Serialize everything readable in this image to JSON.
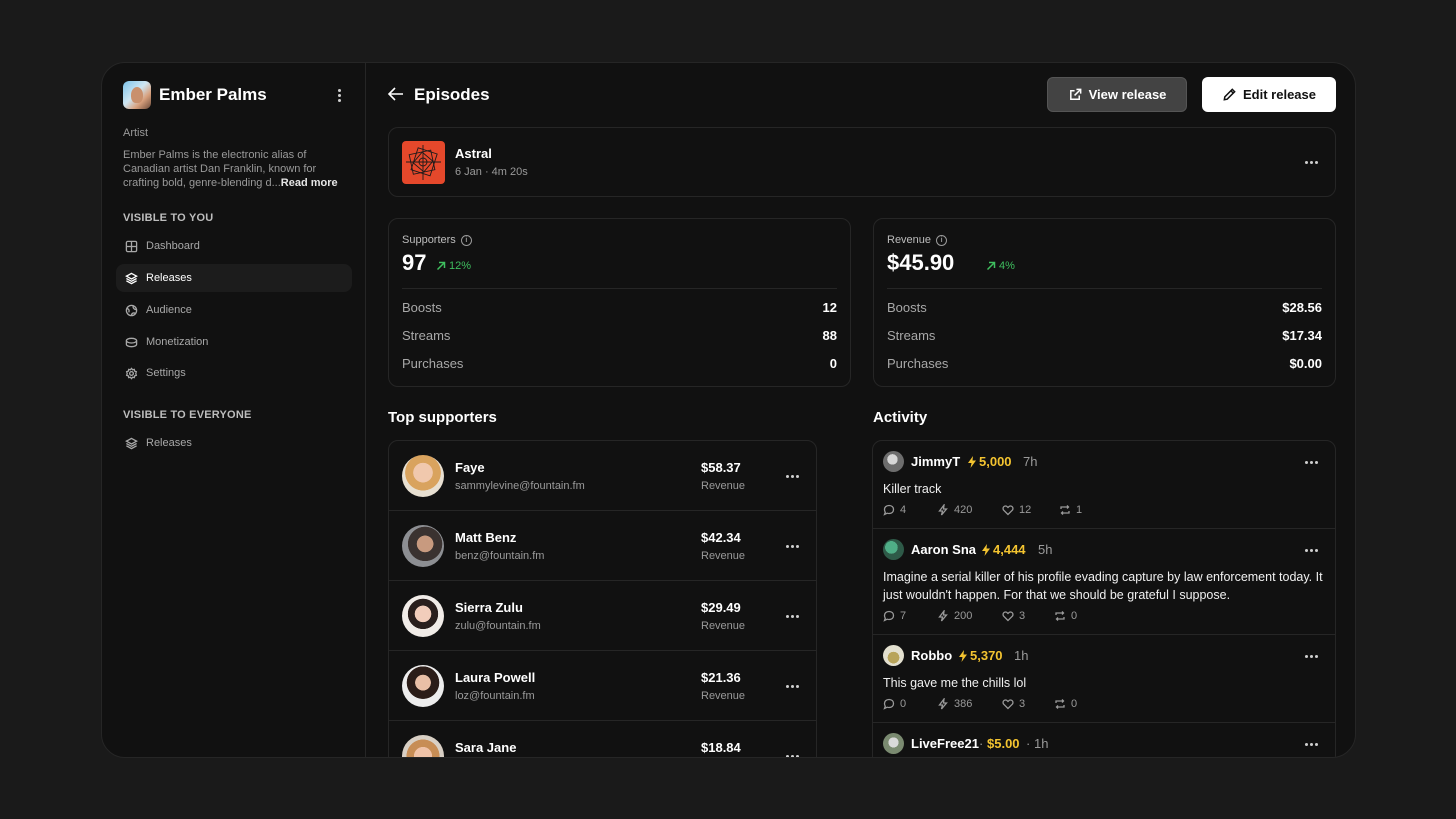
{
  "sidebar": {
    "artist_name": "Ember Palms",
    "artist_role": "Artist",
    "artist_bio": "Ember Palms is the electronic alias of Canadian artist Dan Franklin, known for crafting bold, genre-blending d...",
    "read_more": "Read more",
    "section_visible_to_you": "VISIBLE TO YOU",
    "items_you": [
      {
        "label": "Dashboard",
        "icon": "grid-icon"
      },
      {
        "label": "Releases",
        "icon": "layers-icon",
        "active": true
      },
      {
        "label": "Audience",
        "icon": "globe-icon"
      },
      {
        "label": "Monetization",
        "icon": "coins-icon"
      },
      {
        "label": "Settings",
        "icon": "gear-icon"
      }
    ],
    "section_visible_to_everyone": "VISIBLE TO EVERYONE",
    "items_everyone": [
      {
        "label": "Releases",
        "icon": "layers-icon"
      }
    ]
  },
  "header": {
    "title": "Episodes",
    "view_release": "View release",
    "edit_release": "Edit release"
  },
  "release": {
    "title": "Astral",
    "meta": "6 Jan · 4m 20s",
    "art_color": "#e5482b"
  },
  "stats": {
    "supporters": {
      "label": "Supporters",
      "value": "97",
      "change": "12%",
      "rows": [
        {
          "label": "Boosts",
          "value": "12"
        },
        {
          "label": "Streams",
          "value": "88"
        },
        {
          "label": "Purchases",
          "value": "0"
        }
      ]
    },
    "revenue": {
      "label": "Revenue",
      "value": "$45.90",
      "change": "4%",
      "rows": [
        {
          "label": "Boosts",
          "value": "$28.56"
        },
        {
          "label": "Streams",
          "value": "$17.34"
        },
        {
          "label": "Purchases",
          "value": "$0.00"
        }
      ]
    }
  },
  "top_supporters": {
    "title": "Top supporters",
    "items": [
      {
        "name": "Faye",
        "email": "sammylevine@fountain.fm",
        "amount": "$58.37",
        "amount_label": "Revenue"
      },
      {
        "name": "Matt Benz",
        "email": "benz@fountain.fm",
        "amount": "$42.34",
        "amount_label": "Revenue"
      },
      {
        "name": "Sierra Zulu",
        "email": "zulu@fountain.fm",
        "amount": "$29.49",
        "amount_label": "Revenue"
      },
      {
        "name": "Laura Powell",
        "email": "loz@fountain.fm",
        "amount": "$21.36",
        "amount_label": "Revenue"
      },
      {
        "name": "Sara Jane",
        "email": "",
        "amount": "$18.84",
        "amount_label": ""
      }
    ]
  },
  "activity": {
    "title": "Activity",
    "items": [
      {
        "user": "JimmyT",
        "amount": "5,000",
        "time": "7h",
        "text": "Killer track",
        "comments": "4",
        "boosts": "420",
        "likes": "12",
        "reposts": "1"
      },
      {
        "user": "Aaron Sna",
        "amount": "4,444",
        "time": "5h",
        "text": "Imagine a serial killer of his profile evading capture by law enforcement today. It just wouldn't happen. For that we should be grateful I suppose.",
        "comments": "7",
        "boosts": "200",
        "likes": "3",
        "reposts": "0"
      },
      {
        "user": "Robbo",
        "amount": "5,370",
        "time": "1h",
        "text": "This gave me the chills lol",
        "comments": "0",
        "boosts": "386",
        "likes": "3",
        "reposts": "0"
      },
      {
        "user": "LiveFree21",
        "amount": "$5.00",
        "time": "1h",
        "separator": "·"
      }
    ]
  },
  "colors": {
    "background": "#1a1a1a",
    "panel": "#111111",
    "accent_green": "#3fbf5f",
    "accent_gold": "#f4c430"
  }
}
